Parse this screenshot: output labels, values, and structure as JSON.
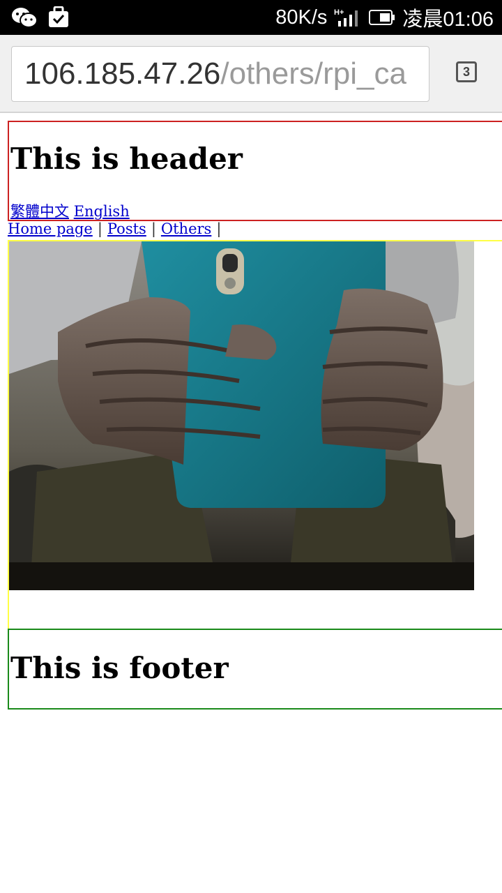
{
  "status_bar": {
    "speed": "80K/s",
    "time": "凌晨01:06",
    "icons": [
      "wechat-icon",
      "bag-check-icon",
      "signal-icon",
      "battery-icon"
    ]
  },
  "browser": {
    "url_host": "106.185.47.26",
    "url_path": "/others/rpi_ca",
    "tab_count": "3"
  },
  "page": {
    "header_title": "This is header",
    "lang_links": [
      "繁體中文",
      "English"
    ],
    "nav": [
      "Home page",
      "Posts",
      "Others"
    ],
    "nav_separator": "|",
    "photo_alt": "camera-snapshot",
    "footer_title": "This is footer"
  },
  "colors": {
    "header_border": "#cc2222",
    "content_border": "#ffff44",
    "footer_border": "#1a8a1a",
    "link": "#0000cc"
  }
}
